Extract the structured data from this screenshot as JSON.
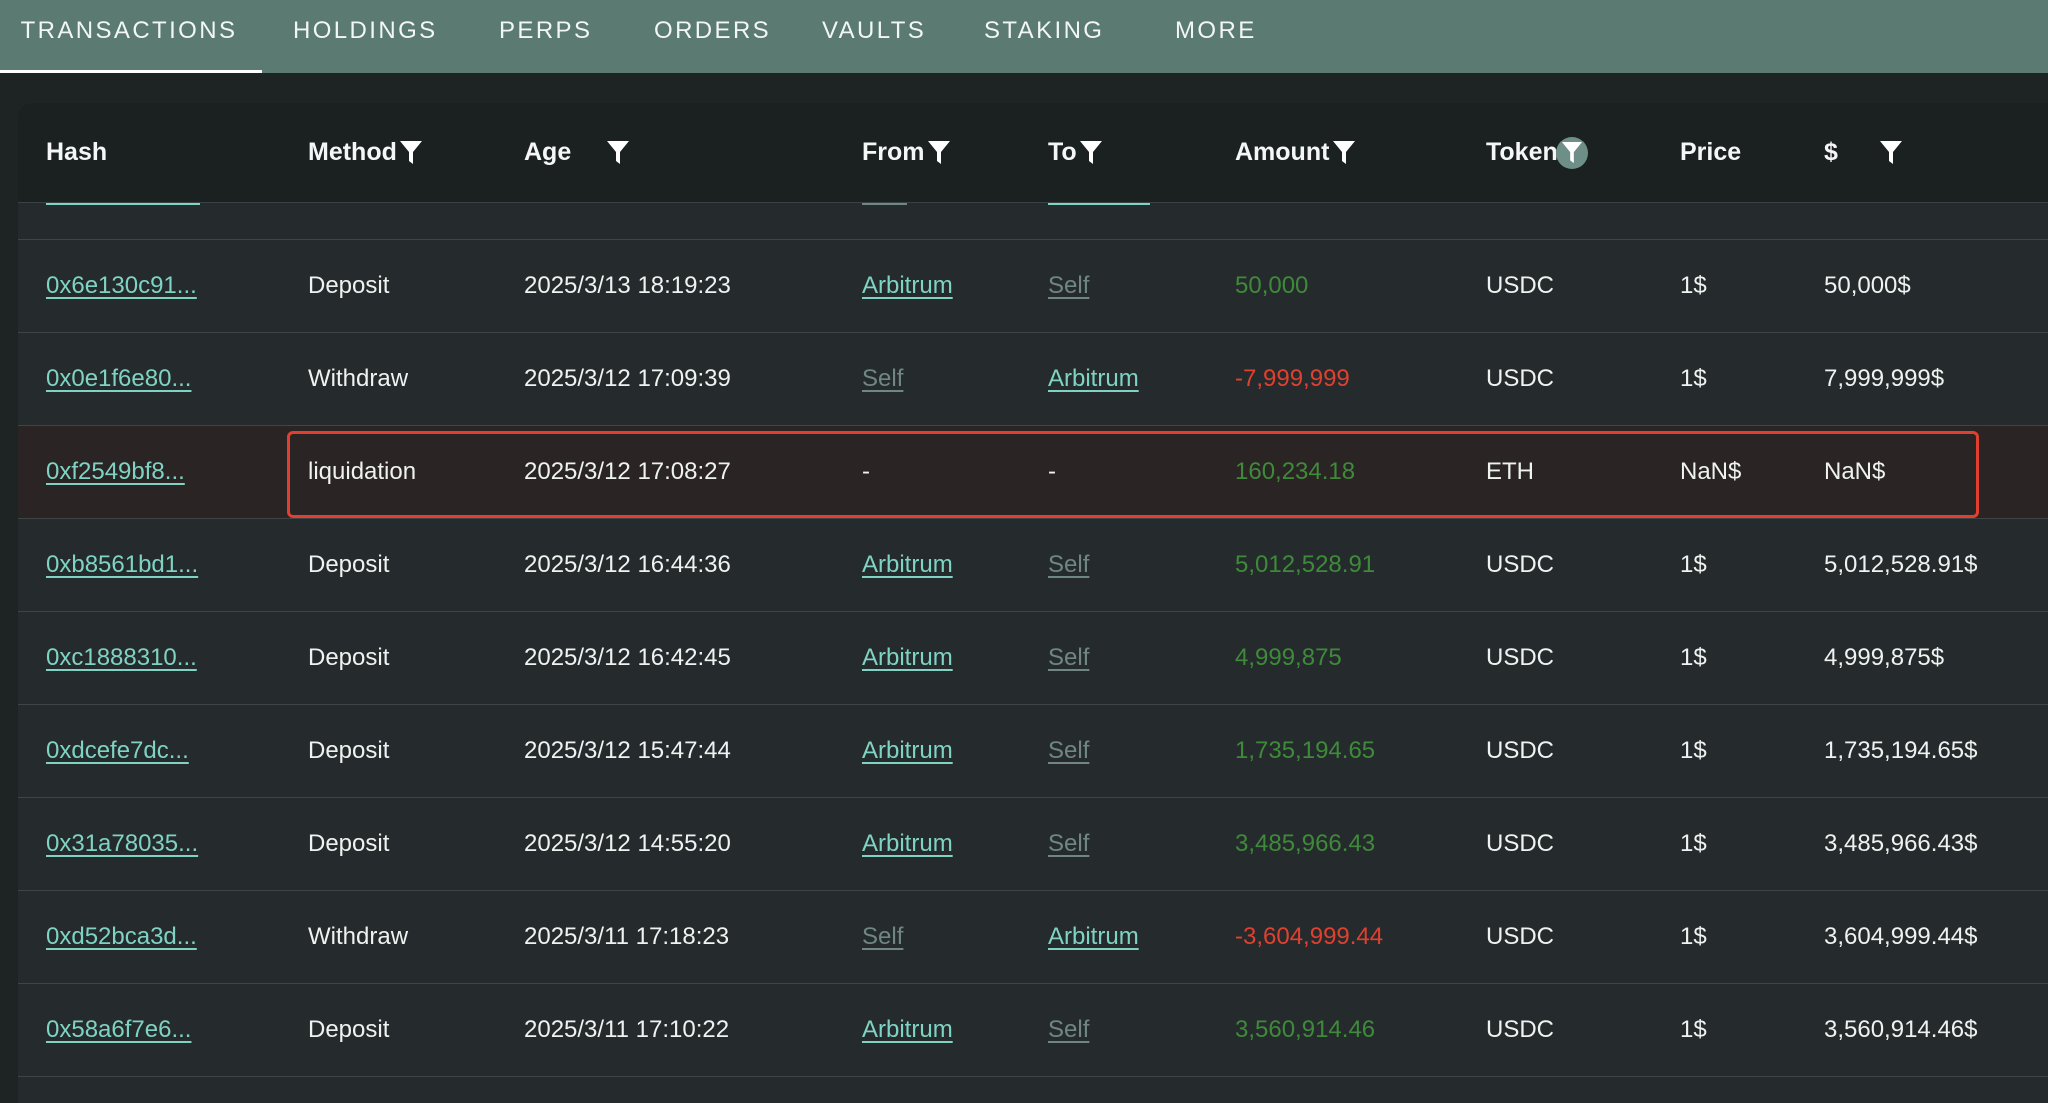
{
  "tabs": [
    {
      "label": "TRANSACTIONS",
      "active": true
    },
    {
      "label": "HOLDINGS",
      "active": false
    },
    {
      "label": "PERPS",
      "active": false
    },
    {
      "label": "ORDERS",
      "active": false
    },
    {
      "label": "VAULTS",
      "active": false
    },
    {
      "label": "STAKING",
      "active": false
    },
    {
      "label": "MORE",
      "active": false
    }
  ],
  "columns": {
    "hash": "Hash",
    "method": "Method",
    "age": "Age",
    "from": "From",
    "to": "To",
    "amount": "Amount",
    "token": "Token",
    "price": "Price",
    "usd": "$"
  },
  "filters": {
    "method": "filter-icon",
    "age": "filter-icon",
    "from": "filter-icon",
    "to": "filter-icon",
    "amount": "filter-icon",
    "token": "filter-icon-active",
    "usd": "filter-icon"
  },
  "colors": {
    "tab_bar": "#5a7a72",
    "link": "#7fd3c4",
    "positive": "#3f8a3a",
    "negative": "#e0402f",
    "highlight_border": "#e0402f"
  },
  "rows": [
    {
      "hash": "0x6e130c91...",
      "method": "Deposit",
      "age": "2025/3/13 18:19:23",
      "from": "Arbitrum",
      "to": "Self",
      "amount": "50,000",
      "amount_sign": "pos",
      "token": "USDC",
      "price": "1$",
      "usd": "50,000$"
    },
    {
      "hash": "0x0e1f6e80...",
      "method": "Withdraw",
      "age": "2025/3/12 17:09:39",
      "from": "Self",
      "to": "Arbitrum",
      "amount": "-7,999,999",
      "amount_sign": "neg",
      "token": "USDC",
      "price": "1$",
      "usd": "7,999,999$"
    },
    {
      "hash": "0xf2549bf8...",
      "method": "liquidation",
      "age": "2025/3/12 17:08:27",
      "from": "-",
      "to": "-",
      "amount": "160,234.18",
      "amount_sign": "pos",
      "token": "ETH",
      "price": "NaN$",
      "usd": "NaN$",
      "highlighted": true
    },
    {
      "hash": "0xb8561bd1...",
      "method": "Deposit",
      "age": "2025/3/12 16:44:36",
      "from": "Arbitrum",
      "to": "Self",
      "amount": "5,012,528.91",
      "amount_sign": "pos",
      "token": "USDC",
      "price": "1$",
      "usd": "5,012,528.91$"
    },
    {
      "hash": "0xc1888310...",
      "method": "Deposit",
      "age": "2025/3/12 16:42:45",
      "from": "Arbitrum",
      "to": "Self",
      "amount": "4,999,875",
      "amount_sign": "pos",
      "token": "USDC",
      "price": "1$",
      "usd": "4,999,875$"
    },
    {
      "hash": "0xdcefe7dc...",
      "method": "Deposit",
      "age": "2025/3/12 15:47:44",
      "from": "Arbitrum",
      "to": "Self",
      "amount": "1,735,194.65",
      "amount_sign": "pos",
      "token": "USDC",
      "price": "1$",
      "usd": "1,735,194.65$"
    },
    {
      "hash": "0x31a78035...",
      "method": "Deposit",
      "age": "2025/3/12 14:55:20",
      "from": "Arbitrum",
      "to": "Self",
      "amount": "3,485,966.43",
      "amount_sign": "pos",
      "token": "USDC",
      "price": "1$",
      "usd": "3,485,966.43$"
    },
    {
      "hash": "0xd52bca3d...",
      "method": "Withdraw",
      "age": "2025/3/11 17:18:23",
      "from": "Self",
      "to": "Arbitrum",
      "amount": "-3,604,999.44",
      "amount_sign": "neg",
      "token": "USDC",
      "price": "1$",
      "usd": "3,604,999.44$"
    },
    {
      "hash": "0x58a6f7e6...",
      "method": "Deposit",
      "age": "2025/3/11 17:10:22",
      "from": "Arbitrum",
      "to": "Self",
      "amount": "3,560,914.46",
      "amount_sign": "pos",
      "token": "USDC",
      "price": "1$",
      "usd": "3,560,914.46$"
    }
  ]
}
